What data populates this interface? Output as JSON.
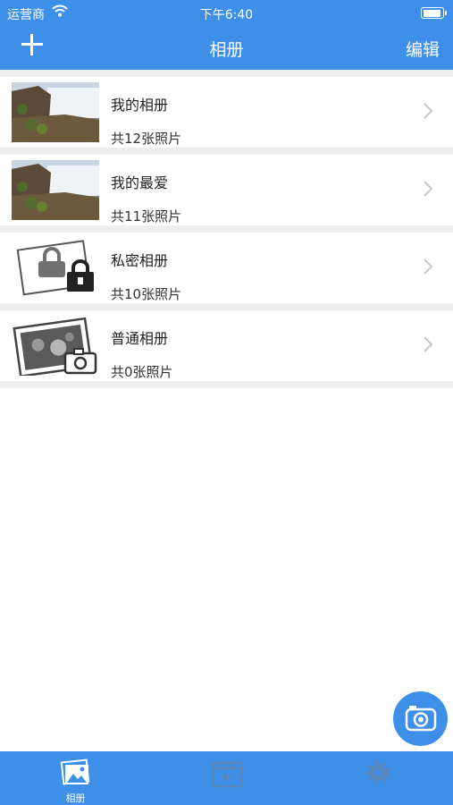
{
  "status_bar": {
    "carrier": "运营商",
    "time": "下午6:40"
  },
  "nav": {
    "title": "相册",
    "edit_label": "编辑",
    "add_icon": "plus-icon"
  },
  "albums": [
    {
      "name": "我的相册",
      "count": "共12张照片",
      "thumb": "waterfall-photo"
    },
    {
      "name": "我的最爱",
      "count": "共11张照片",
      "thumb": "waterfall-photo"
    },
    {
      "name": "私密相册",
      "count": "共10张照片",
      "thumb": "lock-album-icon"
    },
    {
      "name": "普通相册",
      "count": "共0张照片",
      "thumb": "camera-album-icon"
    }
  ],
  "tabs": [
    {
      "label": "相册",
      "icon": "photos-icon",
      "active": true
    },
    {
      "label": "",
      "icon": "video-icon",
      "active": false
    },
    {
      "label": "",
      "icon": "gear-icon",
      "active": false
    }
  ],
  "colors": {
    "primary": "#3d8fe8",
    "separator": "#eeeeee"
  }
}
